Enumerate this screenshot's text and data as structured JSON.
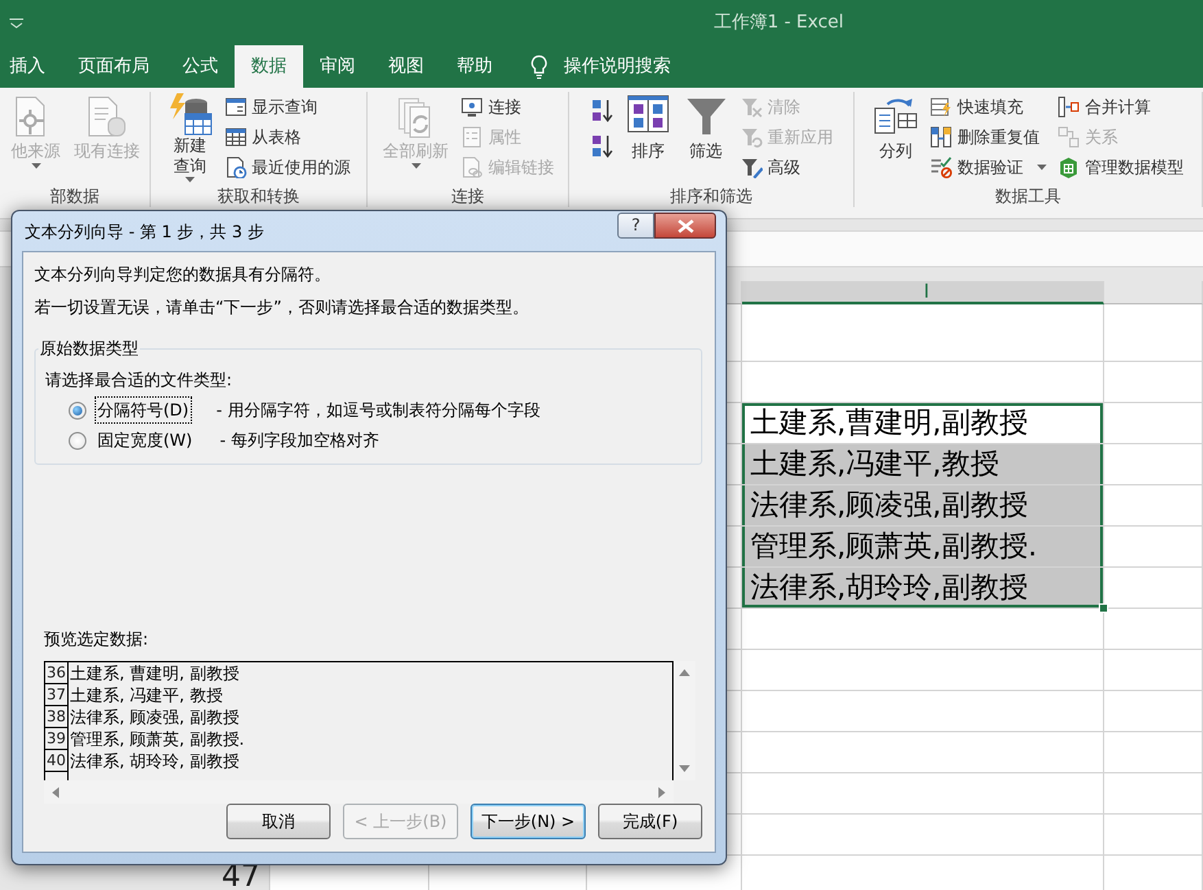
{
  "window": {
    "title": "工作簿1 - Excel"
  },
  "tabs": [
    {
      "label": "插入",
      "selected": false
    },
    {
      "label": "页面布局",
      "selected": false
    },
    {
      "label": "公式",
      "selected": false
    },
    {
      "label": "数据",
      "selected": true
    },
    {
      "label": "审阅",
      "selected": false
    },
    {
      "label": "视图",
      "selected": false
    },
    {
      "label": "帮助",
      "selected": false
    }
  ],
  "search": {
    "label": "操作说明搜索"
  },
  "ribbon": [
    {
      "label": "部数据",
      "columns": [
        [
          {
            "kind": "large",
            "label": "他来源",
            "disabled": true,
            "dropdown": true
          }
        ],
        [
          {
            "kind": "large",
            "label": "现有连接",
            "disabled": true,
            "dropdown": false
          }
        ]
      ]
    },
    {
      "label": "获取和转换",
      "columns": [
        [
          {
            "kind": "tall",
            "label": "新建查询",
            "disabled": false,
            "dropdown": true
          }
        ],
        [
          {
            "kind": "small",
            "label": "显示查询",
            "disabled": false,
            "dropdown": false
          },
          {
            "kind": "small",
            "label": "从表格",
            "disabled": false,
            "dropdown": false
          },
          {
            "kind": "small",
            "label": "最近使用的源",
            "disabled": false,
            "dropdown": false
          }
        ]
      ]
    },
    {
      "label": "连接",
      "columns": [
        [
          {
            "kind": "large",
            "label": "全部刷新",
            "disabled": true,
            "dropdown": true
          }
        ],
        [
          {
            "kind": "small",
            "label": "连接",
            "disabled": false,
            "dropdown": false
          },
          {
            "kind": "small",
            "label": "属性",
            "disabled": true,
            "dropdown": false
          },
          {
            "kind": "small",
            "label": "编辑链接",
            "disabled": true,
            "dropdown": false
          }
        ]
      ]
    },
    {
      "label": "排序和筛选",
      "columns": [
        [
          {
            "kind": "icon",
            "disabled": false
          },
          {
            "kind": "icon",
            "disabled": false
          }
        ],
        [
          {
            "kind": "large",
            "label": "排序",
            "disabled": false,
            "dropdown": false
          }
        ],
        [
          {
            "kind": "large",
            "label": "筛选",
            "disabled": false,
            "dropdown": false
          }
        ],
        [
          {
            "kind": "small",
            "label": "清除",
            "disabled": true,
            "dropdown": false
          },
          {
            "kind": "small",
            "label": "重新应用",
            "disabled": true,
            "dropdown": false
          },
          {
            "kind": "small",
            "label": "高级",
            "disabled": false,
            "dropdown": false
          }
        ]
      ]
    },
    {
      "label": "数据工具",
      "columns": [
        [
          {
            "kind": "large",
            "label": "分列",
            "disabled": false,
            "dropdown": false
          }
        ],
        [
          {
            "kind": "small",
            "label": "快速填充",
            "disabled": false,
            "dropdown": false
          },
          {
            "kind": "small",
            "label": "删除重复值",
            "disabled": false,
            "dropdown": false
          },
          {
            "kind": "small",
            "label": "数据验证",
            "disabled": false,
            "dropdown": true
          }
        ],
        [
          {
            "kind": "small",
            "label": "合并计算",
            "disabled": false,
            "dropdown": false
          },
          {
            "kind": "small",
            "label": "关系",
            "disabled": true,
            "dropdown": false
          },
          {
            "kind": "small",
            "label": "管理数据模型",
            "disabled": false,
            "dropdown": false
          }
        ]
      ]
    }
  ],
  "sheet": {
    "column_header": "I",
    "row_header": "47",
    "cells": [
      {
        "text": "土建系,曹建明,副教授",
        "active": true
      },
      {
        "text": "土建系,冯建平,教授",
        "active": false
      },
      {
        "text": "法律系,顾凌强,副教授",
        "active": false
      },
      {
        "text": "管理系,顾萧英,副教授.",
        "active": false
      },
      {
        "text": "法律系,胡玲玲,副教授",
        "active": false
      }
    ]
  },
  "dialog": {
    "title": "文本分列向导 - 第 1 步，共 3 步",
    "help": "?",
    "intro": [
      "文本分列向导判定您的数据具有分隔符。",
      "若一切设置无误，请单击“下一步”，否则请选择最合适的数据类型。"
    ],
    "group_title": "原始数据类型",
    "prompt": "请选择最合适的文件类型:",
    "options": [
      {
        "label": "分隔符号(D)",
        "description": "- 用分隔字符，如逗号或制表符分隔每个字段",
        "selected": true
      },
      {
        "label": "固定宽度(W)",
        "description": "- 每列字段加空格对齐",
        "selected": false
      }
    ],
    "preview_label": "预览选定数据:",
    "preview_rows": [
      {
        "number": "36",
        "text": "土建系, 曹建明, 副教授"
      },
      {
        "number": "37",
        "text": "土建系, 冯建平, 教授"
      },
      {
        "number": "38",
        "text": "法律系, 顾凌强, 副教授"
      },
      {
        "number": "39",
        "text": "管理系, 顾萧英, 副教授."
      },
      {
        "number": "40",
        "text": "法律系, 胡玲玲, 副教授"
      }
    ],
    "buttons": [
      {
        "label": "取消",
        "disabled": false,
        "default": false
      },
      {
        "label": "< 上一步(B)",
        "disabled": true,
        "default": false
      },
      {
        "label": "下一步(N) >",
        "disabled": false,
        "default": true
      },
      {
        "label": "完成(F)",
        "disabled": false,
        "default": false
      }
    ]
  }
}
